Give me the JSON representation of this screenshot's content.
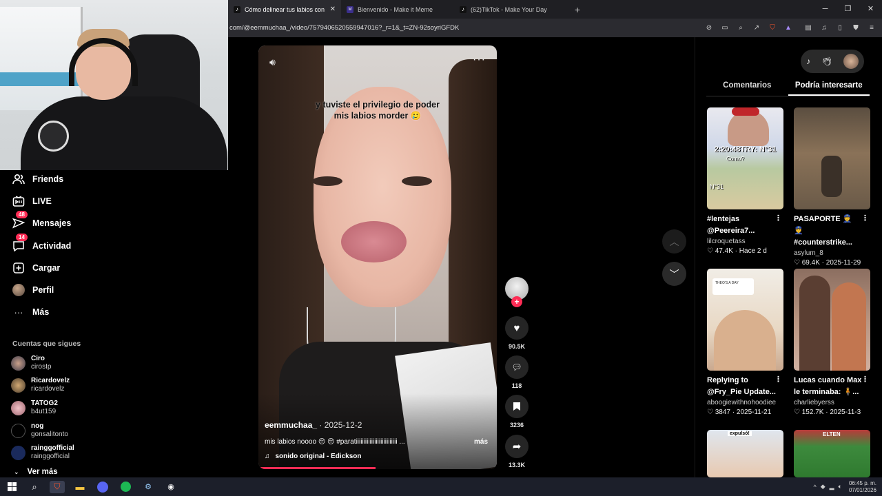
{
  "browser": {
    "tabs": [
      {
        "label": "Cómo delinear tus labios con est",
        "active": true,
        "favicon": "tiktok-icon"
      },
      {
        "label": "Bienvenido - Make it Meme",
        "active": false,
        "favicon": "mim-icon"
      },
      {
        "label": "(62)TikTok - Make Your Day",
        "active": false,
        "favicon": "tiktok-icon"
      }
    ],
    "url": "com/@eemmuchaa_/video/7579406520559947016?_r=1&_t=ZN-92soyriGFDK"
  },
  "sidebar": {
    "items": [
      {
        "label": "Friends",
        "icon": "friends-icon",
        "badge": ""
      },
      {
        "label": "LIVE",
        "icon": "live-icon",
        "badge": ""
      },
      {
        "label": "Mensajes",
        "icon": "messages-icon",
        "badge": "48"
      },
      {
        "label": "Actividad",
        "icon": "activity-icon",
        "badge": "14"
      },
      {
        "label": "Cargar",
        "icon": "upload-icon",
        "badge": ""
      },
      {
        "label": "Perfil",
        "icon": "profile-avatar",
        "badge": ""
      },
      {
        "label": "Más",
        "icon": "more-icon",
        "badge": ""
      }
    ],
    "following_title": "Cuentas que sigues",
    "following": [
      {
        "name": "Ciro",
        "handle": "cirosIp"
      },
      {
        "name": "Ricardovelz",
        "handle": "ricardovelz"
      },
      {
        "name": "TATOG2",
        "handle": "b4ut159"
      },
      {
        "name": "nog",
        "handle": "gonsalitonto"
      },
      {
        "name": "rainggofficial",
        "handle": "rainggofficial"
      }
    ],
    "see_more": "Ver más"
  },
  "video": {
    "caption_line1": "y tuviste el privilegio de poder",
    "caption_line2": "mis labios morder 🥲",
    "username": "eemmuchaa_",
    "date": " · 2025-12-2",
    "description": "mis labios noooo 😔 😔 #paratiiiiiiiiiiiiiiiiiiiiiiiiiii ...",
    "more_label": "más",
    "sound": "sonido original - Edickson",
    "progress": 0.49
  },
  "actions": {
    "likes": "90.5K",
    "comments": "118",
    "saves": "3236",
    "shares": "13.3K"
  },
  "right_panel": {
    "tabs": [
      "Comentarios",
      "Podría interesarte"
    ],
    "active_tab": 1,
    "cards": [
      {
        "title": "#lentejas @Peereira7...",
        "author": "lilcroquetass",
        "likes": "47.4K",
        "date": "Hace 2 d"
      },
      {
        "title": "PASAPORTE 👮 👮 #counterstrike...",
        "author": "asylum_8",
        "likes": "69.4K",
        "date": "2025-11-29"
      },
      {
        "title": "Replying to @Fry_Pie Update...",
        "author": "aboogiewithnohoodiee",
        "likes": "3847",
        "date": "2025-11-21"
      },
      {
        "title": "Lucas cuando Max le terminaba: 🧍...",
        "author": "charliebyerss",
        "likes": "152.7K",
        "date": "2025-11-3"
      }
    ],
    "thumb_texts": [
      "2:20:48TRY: N°31",
      "Como?",
      "N°31",
      "THEO'S A DAY",
      "expulsó!",
      "ELTEN"
    ]
  },
  "taskbar": {
    "time": "06:45 p. m.",
    "date": "07/01/2026"
  },
  "colors": {
    "accent": "#fe2c55",
    "background": "#000000"
  }
}
